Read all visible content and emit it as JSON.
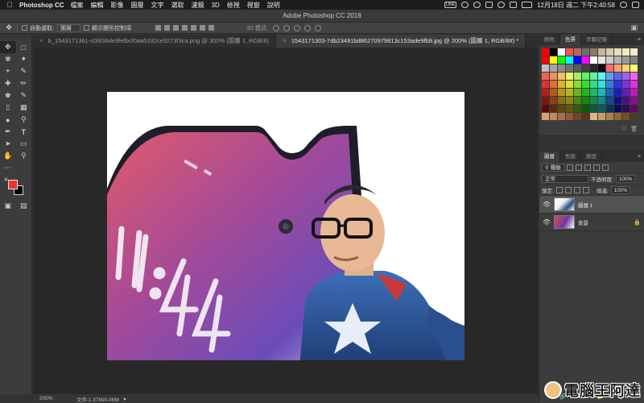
{
  "menubar": {
    "app": "Photoshop CC",
    "items": [
      "檔案",
      "編輯",
      "影像",
      "圖層",
      "文字",
      "選取",
      "濾鏡",
      "3D",
      "檢視",
      "視窗",
      "說明"
    ],
    "clock": "12月18日 週二 下午2:40:58",
    "lang": "LINE"
  },
  "titlebar": {
    "title": "Adobe Photoshop CC 2018"
  },
  "options": {
    "auto_select": "自動選取:",
    "auto_select_value": "圖層",
    "show_transform": "顯示變形控制項",
    "mode3d": "3D 模式:"
  },
  "tabs": [
    {
      "label": "b_1543171361-c0fd36de9fefbcf0aa5332ce9273f3ca.png @ 300% (圖層 1, RGB/8)",
      "active": false
    },
    {
      "label": "1543171303-7db23491bd86270979813c153ade9fb8.jpg @ 200% (圖層 1, RGB/8#) *",
      "active": true
    }
  ],
  "status": {
    "zoom": "200%",
    "doc": "文件:1.37M/4.06M"
  },
  "panels": {
    "top_tabs": [
      "顏色",
      "色票",
      "步驟記錄"
    ],
    "layer_tabs": [
      "圖層",
      "色版",
      "路徑"
    ],
    "kind": "種類",
    "blend": "正常",
    "opacity_label": "不透明度:",
    "opacity": "100%",
    "lock_label": "鎖定:",
    "fill_label": "填滿:",
    "fill": "100%",
    "layers": [
      {
        "name": "圖層 1",
        "selected": true,
        "locked": false
      },
      {
        "name": "背景",
        "selected": false,
        "locked": true
      }
    ]
  },
  "watermark": {
    "text": "電腦王阿達"
  },
  "swatch_colors": [
    [
      "#ff0000",
      "#000000",
      "#ffffff",
      "#ff4f4f",
      "#b46a5a",
      "#6e6e6e",
      "#8a7a66",
      "#c8b89a",
      "#d8cba8",
      "#e9deb8",
      "#f3e6c0",
      "#f6e8c4"
    ],
    [
      "#ff0000",
      "#ffff00",
      "#00ff00",
      "#00ffff",
      "#0000ff",
      "#ff00ff",
      "#ffffff",
      "#e6e6e6",
      "#cccccc",
      "#b3b3b3",
      "#999999",
      "#808080"
    ],
    [
      "#c0c0c0",
      "#a6a6a6",
      "#8c8c8c",
      "#737373",
      "#595959",
      "#404040",
      "#262626",
      "#0d0d0d",
      "#ff6b6b",
      "#ff9f6b",
      "#ffd26b",
      "#ffff6b"
    ],
    [
      "#f06060",
      "#f09060",
      "#f0c060",
      "#f0f060",
      "#a0f060",
      "#60f060",
      "#60f0a0",
      "#60f0f0",
      "#60a0f0",
      "#6060f0",
      "#a060f0",
      "#f060f0"
    ],
    [
      "#e03030",
      "#e07030",
      "#e0b030",
      "#e0e030",
      "#80e030",
      "#30e030",
      "#30e080",
      "#30e0e0",
      "#3080e0",
      "#3030e0",
      "#8030e0",
      "#e030e0"
    ],
    [
      "#b81c1c",
      "#b8581c",
      "#b8961c",
      "#b8b81c",
      "#64b81c",
      "#1cb81c",
      "#1cb864",
      "#1cb8b8",
      "#1c64b8",
      "#1c1cb8",
      "#641cb8",
      "#b81cb8"
    ],
    [
      "#8a1010",
      "#8a4010",
      "#8a7010",
      "#8a8a10",
      "#4a8a10",
      "#108a10",
      "#108a4a",
      "#108a8a",
      "#104a8a",
      "#10108a",
      "#4a108a",
      "#8a108a"
    ],
    [
      "#5c0a0a",
      "#5c2a0a",
      "#5c4a0a",
      "#5c5c0a",
      "#325c0a",
      "#0a5c0a",
      "#0a5c32",
      "#0a5c5c",
      "#0a325c",
      "#0a0a5c",
      "#320a5c",
      "#5c0a5c"
    ],
    [
      "#d9a07a",
      "#c48a5e",
      "#a8704a",
      "#8c5a38",
      "#704628",
      "#54341c",
      "#d9b68a",
      "#c49e6e",
      "#a88252",
      "#8c683c",
      "#70502a",
      "#543a1c"
    ]
  ]
}
